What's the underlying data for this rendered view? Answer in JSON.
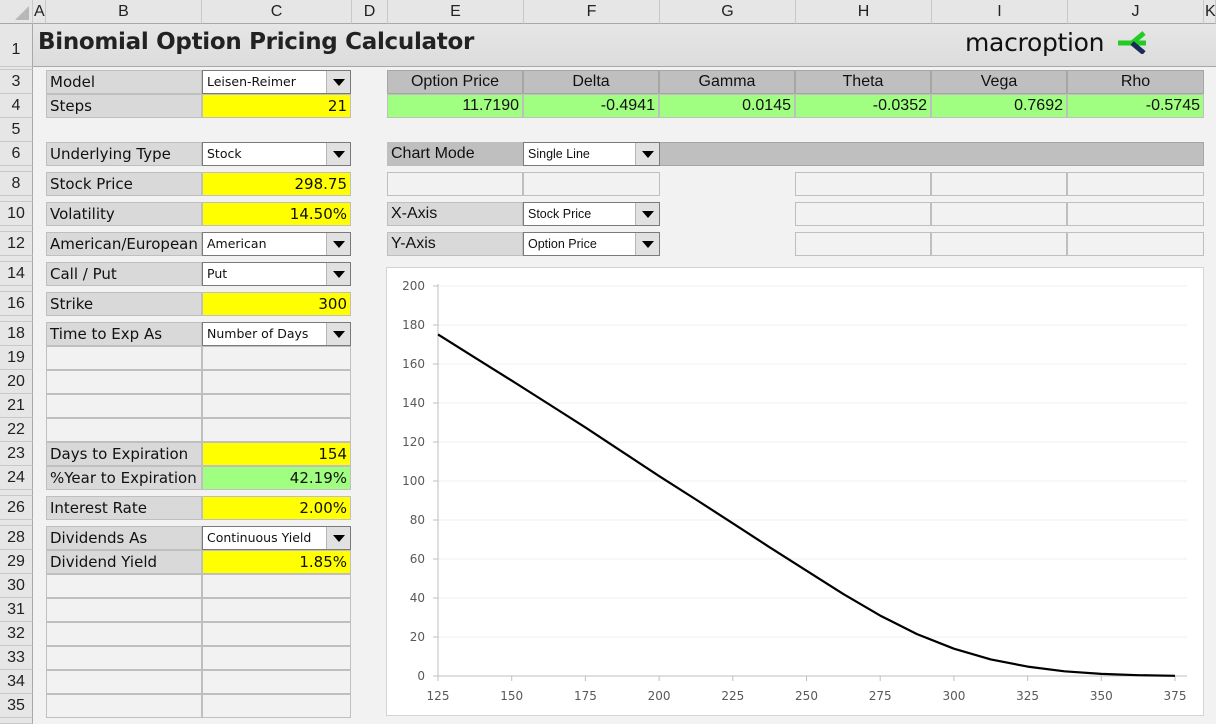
{
  "sheet": {
    "columns": [
      "A",
      "B",
      "C",
      "D",
      "E",
      "F",
      "G",
      "H",
      "I",
      "J",
      "K"
    ],
    "rows": [
      "1",
      "3",
      "4",
      "5",
      "6",
      "8",
      "10",
      "12",
      "14",
      "16",
      "18",
      "19",
      "20",
      "21",
      "22",
      "23",
      "24",
      "26",
      "28",
      "29",
      "30",
      "31",
      "32",
      "33",
      "34",
      "35"
    ]
  },
  "header": {
    "title": "Binomial Option Pricing Calculator",
    "logo_text": "macroption",
    "logo_colors": {
      "green": "#22cc22",
      "navy": "#1a2b55"
    }
  },
  "inputs": {
    "model": {
      "label": "Model",
      "value": "Leisen-Reimer"
    },
    "steps": {
      "label": "Steps",
      "value": "21"
    },
    "underlying_type": {
      "label": "Underlying Type",
      "value": "Stock"
    },
    "stock_price": {
      "label": "Stock Price",
      "value": "298.75"
    },
    "volatility": {
      "label": "Volatility",
      "value": "14.50%"
    },
    "exercise_style": {
      "label": "American/European",
      "value": "American"
    },
    "call_put": {
      "label": "Call / Put",
      "value": "Put"
    },
    "strike": {
      "label": "Strike",
      "value": "300"
    },
    "time_to_exp_as": {
      "label": "Time to Exp As",
      "value": "Number of Days"
    },
    "days_to_expiration": {
      "label": "Days to Expiration",
      "value": "154"
    },
    "pct_year_to_expiration": {
      "label": "%Year to Expiration",
      "value": "42.19%"
    },
    "interest_rate": {
      "label": "Interest Rate",
      "value": "2.00%"
    },
    "dividends_as": {
      "label": "Dividends As",
      "value": "Continuous Yield"
    },
    "dividend_yield": {
      "label": "Dividend Yield",
      "value": "1.85%"
    }
  },
  "results": {
    "headers": [
      "Option Price",
      "Delta",
      "Gamma",
      "Theta",
      "Vega",
      "Rho"
    ],
    "values": [
      "11.7190",
      "-0.4941",
      "0.0145",
      "-0.0352",
      "0.7692",
      "-0.5745"
    ]
  },
  "chart_settings": {
    "chart_mode": {
      "label": "Chart Mode",
      "value": "Single Line"
    },
    "x_axis": {
      "label": "X-Axis",
      "value": "Stock Price"
    },
    "y_axis": {
      "label": "Y-Axis",
      "value": "Option Price"
    }
  },
  "colors": {
    "input_yellow": "#ffff00",
    "output_green": "#a0ff80",
    "label_gray": "#d9d9d9"
  },
  "chart_data": {
    "type": "line",
    "title": "",
    "xlabel": "",
    "ylabel": "",
    "xlim": [
      125,
      375
    ],
    "ylim": [
      0,
      200
    ],
    "xticks": [
      125,
      150,
      175,
      200,
      225,
      250,
      275,
      300,
      325,
      350,
      375
    ],
    "yticks": [
      0,
      20,
      40,
      60,
      80,
      100,
      120,
      140,
      160,
      180,
      200
    ],
    "grid": true,
    "legend": "none",
    "series": [
      {
        "name": "Option Price",
        "color": "#000000",
        "x": [
          125,
          137.5,
          150,
          162.5,
          175,
          187.5,
          200,
          212.5,
          225,
          237.5,
          250,
          262.5,
          275,
          287.5,
          300,
          312.5,
          325,
          337.5,
          350,
          362.5,
          375
        ],
        "y": [
          175.2,
          163.3,
          151.5,
          139.5,
          127.5,
          115.0,
          102.5,
          90.5,
          78.3,
          66.0,
          54.0,
          42.0,
          31.0,
          21.5,
          14.0,
          8.5,
          4.8,
          2.4,
          1.1,
          0.4,
          0.1
        ]
      }
    ]
  }
}
